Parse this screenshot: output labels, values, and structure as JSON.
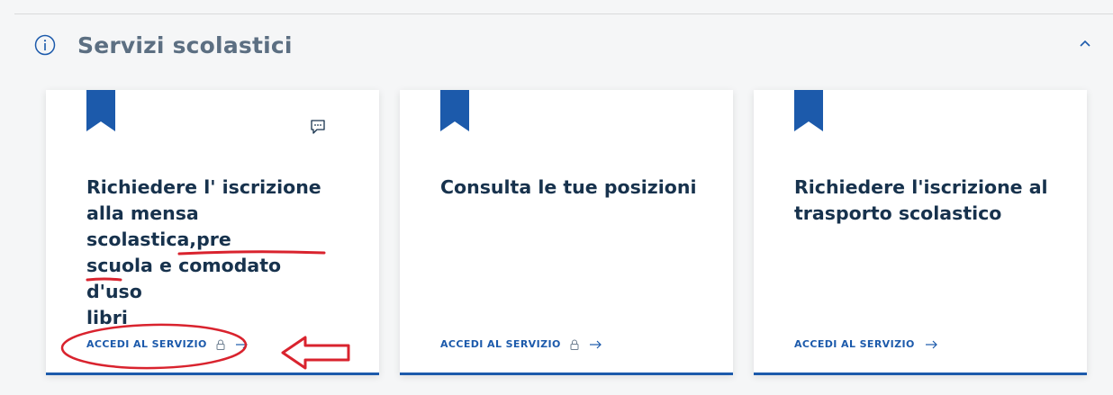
{
  "section": {
    "title": "Servizi scolastici",
    "info_icon": "info-circle-icon",
    "collapse_icon": "chevron-up-icon"
  },
  "cards": [
    {
      "title_lines": [
        "Richiedere l' iscrizione",
        "alla mensa scolastica,pre",
        "scuola e comodato d'uso",
        "libri"
      ],
      "link_label": "ACCEDI AL SERVIZIO",
      "has_lock": true,
      "has_chat": true
    },
    {
      "title_lines": [
        "Consulta le tue posizioni"
      ],
      "link_label": "ACCEDI AL SERVIZIO",
      "has_lock": true,
      "has_chat": false
    },
    {
      "title_lines": [
        "Richiedere l'iscrizione al",
        "trasporto scolastico"
      ],
      "link_label": "ACCEDI AL SERVIZIO",
      "has_lock": false,
      "has_chat": false
    }
  ],
  "colors": {
    "primary": "#1c5aab",
    "title": "#17324d",
    "section_title": "#5c6f82",
    "annotation": "#d9232e",
    "background": "#f5f6f7"
  },
  "annotations": {
    "underline": "red-underline",
    "circle": "red-ellipse",
    "arrow": "red-left-arrow"
  }
}
